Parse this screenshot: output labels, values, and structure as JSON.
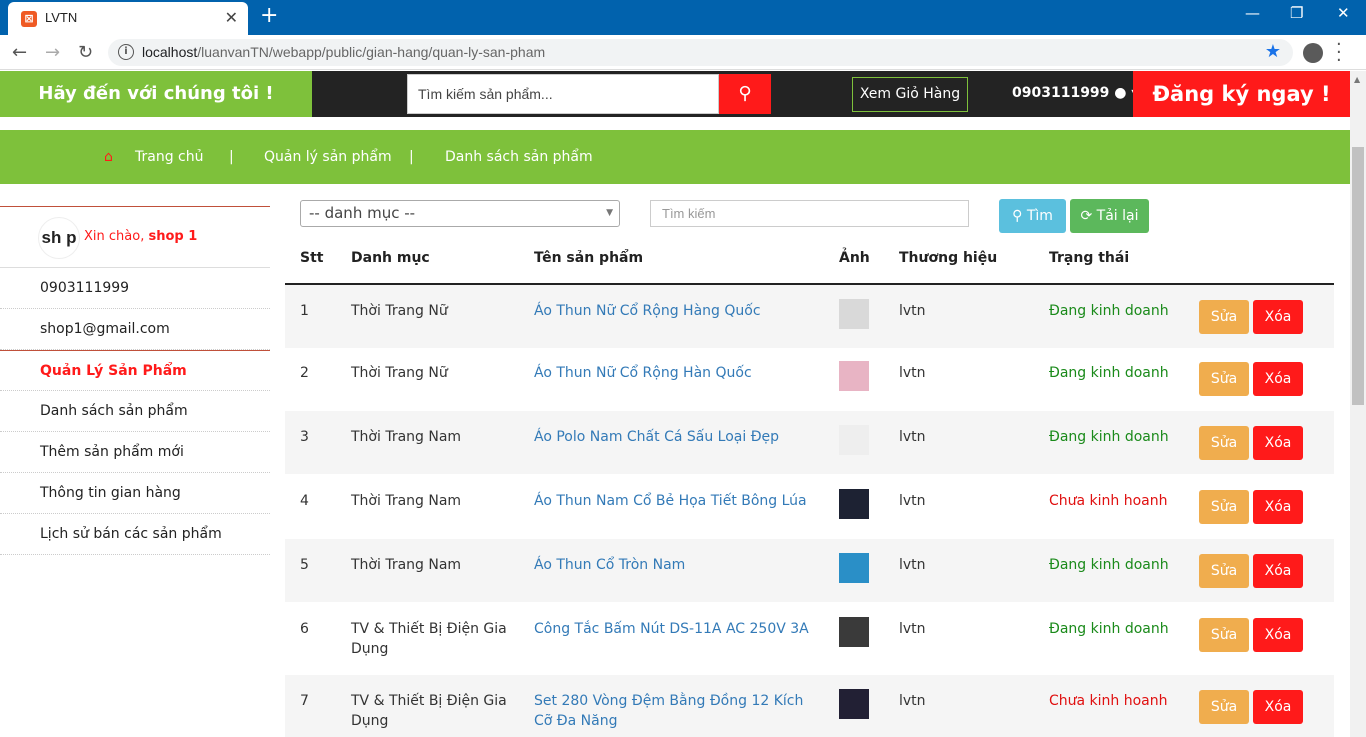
{
  "browser": {
    "tab_title": "LVTN",
    "url_host": "localhost",
    "url_path": "/luanvanTN/webapp/public/gian-hang/quan-ly-san-pham"
  },
  "header": {
    "welcome": "Hãy đến với chúng tôi !",
    "search_placeholder": "Tìm kiếm sản phẩm...",
    "cart_label": "Xem Giỏ Hàng",
    "phone": "0903111999",
    "register": "Đăng ký ngay !"
  },
  "breadcrumb": [
    "Trang chủ",
    "Quản lý sản phẩm",
    "Danh sách sản phẩm"
  ],
  "sidebar": {
    "avatar_text": "sh p",
    "hello_prefix": "Xin chào,",
    "hello_name": "shop 1",
    "items": [
      {
        "label": "0903111999",
        "active": false
      },
      {
        "label": "shop1@gmail.com",
        "active": false
      },
      {
        "label": "Quản Lý Sản Phẩm",
        "active": true
      },
      {
        "label": "Danh sách sản phẩm",
        "active": false
      },
      {
        "label": "Thêm sản phẩm mới",
        "active": false
      },
      {
        "label": "Thông tin gian hàng",
        "active": false
      },
      {
        "label": "Lịch sử bán các sản phẩm",
        "active": false
      }
    ]
  },
  "filters": {
    "category_selected": "-- danh mục --",
    "search_placeholder": "Tìm kiếm",
    "find_label": "Tìm",
    "reload_label": "Tải lại"
  },
  "table": {
    "headers": [
      "Stt",
      "Danh mục",
      "Tên sản phẩm",
      "Ảnh",
      "Thương hiệu",
      "Trạng thái"
    ],
    "edit_label": "Sửa",
    "delete_label": "Xóa",
    "rows": [
      {
        "stt": "1",
        "category": "Thời Trang Nữ",
        "name": "Áo Thun Nữ Cổ Rộng Hàng Quốc",
        "brand": "lvtn",
        "status": "Đang kinh doanh",
        "active": true,
        "thumb_color": "#d9d9d9"
      },
      {
        "stt": "2",
        "category": "Thời Trang Nữ",
        "name": "Áo Thun Nữ Cổ Rộng Hàn Quốc",
        "brand": "lvtn",
        "status": "Đang kinh doanh",
        "active": true,
        "thumb_color": "#e8b4c4"
      },
      {
        "stt": "3",
        "category": "Thời Trang Nam",
        "name": "Áo Polo Nam Chất Cá Sấu Loại Đẹp",
        "brand": "lvtn",
        "status": "Đang kinh doanh",
        "active": true,
        "thumb_color": "#eeeeee"
      },
      {
        "stt": "4",
        "category": "Thời Trang Nam",
        "name": "Áo Thun Nam Cổ Bẻ Họa Tiết Bông Lúa",
        "brand": "lvtn",
        "status": "Chưa kinh hoanh",
        "active": false,
        "thumb_color": "#1d2233"
      },
      {
        "stt": "5",
        "category": "Thời Trang Nam",
        "name": "Áo Thun Cổ Tròn Nam",
        "brand": "lvtn",
        "status": "Đang kinh doanh",
        "active": true,
        "thumb_color": "#2a8fc7"
      },
      {
        "stt": "6",
        "category": "TV & Thiết Bị Điện Gia Dụng",
        "name": "Công Tắc Bấm Nút DS-11A AC 250V 3A",
        "brand": "lvtn",
        "status": "Đang kinh doanh",
        "active": true,
        "thumb_color": "#3a3a3a"
      },
      {
        "stt": "7",
        "category": "TV & Thiết Bị Điện Gia Dụng",
        "name": "Set 280 Vòng Đệm Bằng Đồng 12 Kích Cỡ Đa Năng",
        "brand": "lvtn",
        "status": "Chưa kinh hoanh",
        "active": false,
        "thumb_color": "#222034"
      }
    ]
  }
}
